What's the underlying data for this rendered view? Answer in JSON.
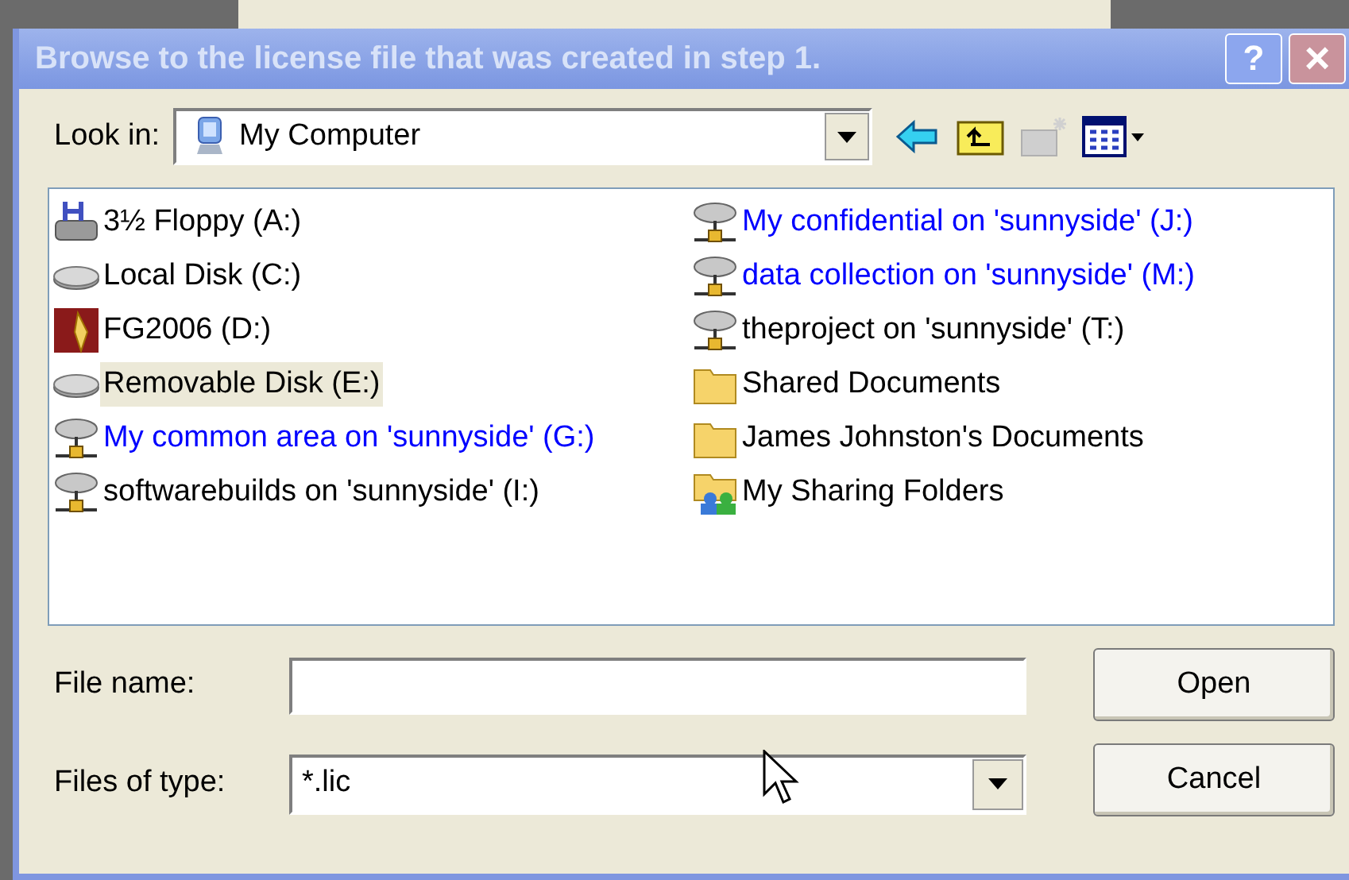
{
  "window": {
    "title": "Browse to the license file that was created in step 1.",
    "help": "?",
    "close": "×"
  },
  "look_in": {
    "label": "Look in:",
    "value": "My Computer"
  },
  "items": [
    {
      "label": "3½ Floppy (A:)",
      "kind": "floppy",
      "color": "#000000",
      "selected": false
    },
    {
      "label": "Local Disk (C:)",
      "kind": "disk",
      "color": "#000000",
      "selected": false
    },
    {
      "label": "FG2006 (D:)",
      "kind": "app",
      "color": "#000000",
      "selected": false
    },
    {
      "label": "Removable Disk (E:)",
      "kind": "disk",
      "color": "#000000",
      "selected": true
    },
    {
      "label": "My common area on 'sunnyside' (G:)",
      "kind": "network",
      "color": "#0000ff",
      "selected": false
    },
    {
      "label": "softwarebuilds on 'sunnyside' (I:)",
      "kind": "network",
      "color": "#000000",
      "selected": false
    },
    {
      "label": "My confidential on 'sunnyside' (J:)",
      "kind": "network",
      "color": "#0000ff",
      "selected": false
    },
    {
      "label": "data collection on 'sunnyside' (M:)",
      "kind": "network",
      "color": "#0000ff",
      "selected": false
    },
    {
      "label": "theproject on 'sunnyside' (T:)",
      "kind": "network",
      "color": "#000000",
      "selected": false
    },
    {
      "label": "Shared Documents",
      "kind": "folder",
      "color": "#000000",
      "selected": false
    },
    {
      "label": "James Johnston's Documents",
      "kind": "folder",
      "color": "#000000",
      "selected": false
    },
    {
      "label": "My Sharing Folders",
      "kind": "shared",
      "color": "#000000",
      "selected": false
    }
  ],
  "file_name": {
    "label": "File name:"
  },
  "files_of_type": {
    "label": "Files of type:",
    "value": "*.lic"
  },
  "buttons": [
    "Open",
    "Cancel"
  ]
}
